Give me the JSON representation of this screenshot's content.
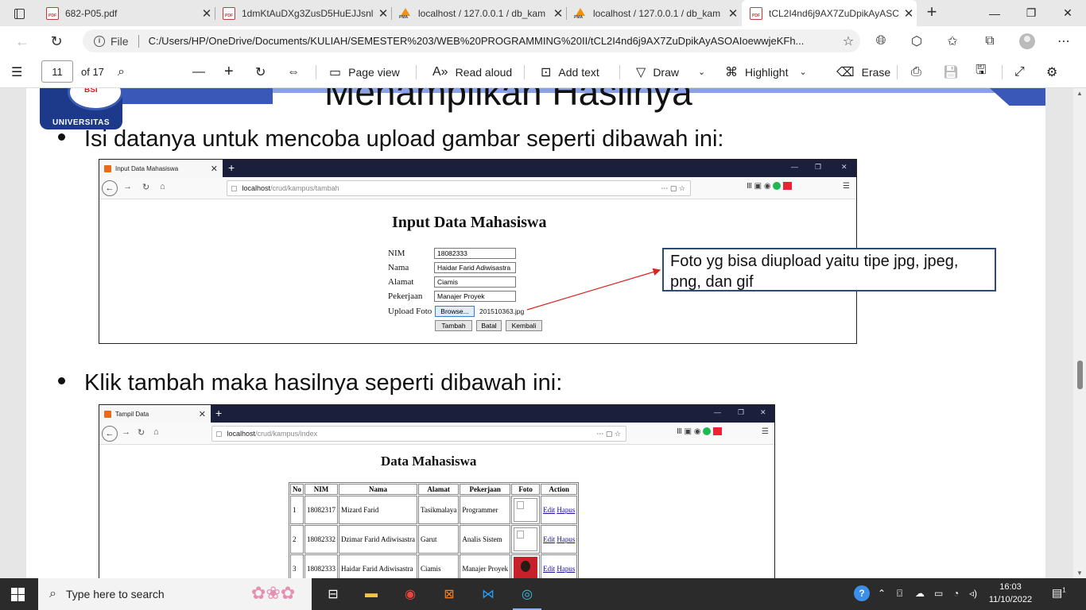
{
  "tabs": [
    {
      "title": "682-P05.pdf",
      "icon": "pdf-icon"
    },
    {
      "title": "1dmKtAuDXg3ZusD5HuEJJsnl",
      "icon": "pdf-icon"
    },
    {
      "title": "localhost / 127.0.0.1 / db_kam",
      "icon": "phpmyadmin-icon"
    },
    {
      "title": "localhost / 127.0.0.1 / db_kam",
      "icon": "phpmyadmin-icon"
    },
    {
      "title": "tCL2I4nd6j9AX7ZuDpikAyASC",
      "icon": "pdf-icon",
      "active": true
    }
  ],
  "address": {
    "label": "File",
    "url": "C:/Users/HP/OneDrive/Documents/KULIAH/SEMESTER%203/WEB%20PROGRAMMING%20II/tCL2I4nd6j9AX7ZuDpikAyASOAIoewwjeKFh..."
  },
  "pdf_toolbar": {
    "page_current": "11",
    "page_total": "of 17",
    "page_view": "Page view",
    "read_aloud": "Read aloud",
    "add_text": "Add text",
    "draw": "Draw",
    "highlight": "Highlight",
    "erase": "Erase"
  },
  "slide": {
    "title": "Menampilkan Hasilnya",
    "logo_text": "UNIVERSITAS",
    "logo_mark": "BSI",
    "bullet1": "Isi datanya untuk mencoba upload gambar seperti dibawah ini:",
    "bullet2": "Klik tambah maka hasilnya seperti dibawah ini:",
    "callout": "Foto yg bisa diupload yaitu tipe jpg, jpeg, png, dan gif"
  },
  "shot1": {
    "tab_title": "Input Data Mahasiswa",
    "url_host": "localhost",
    "url_path": "/crud/kampus/tambah",
    "form_title": "Input Data Mahasiswa",
    "fields": [
      {
        "label": "NIM",
        "value": "18082333"
      },
      {
        "label": "Nama",
        "value": "Haidar Farid Adiwisastra"
      },
      {
        "label": "Alamat",
        "value": "Ciamis"
      },
      {
        "label": "Pekerjaan",
        "value": "Manajer Proyek"
      }
    ],
    "upload_label": "Upload Foto",
    "browse": "Browse...",
    "file_name": "201510363.jpg",
    "btn_add": "Tambah",
    "btn_cancel": "Batal",
    "btn_back": "Kembali"
  },
  "shot2": {
    "tab_title": "Tampil Data",
    "url_host": "localhost",
    "url_path": "/crud/kampus/index",
    "heading": "Data Mahasiswa",
    "columns": [
      "No",
      "NIM",
      "Nama",
      "Alamat",
      "Pekerjaan",
      "Foto",
      "Action"
    ],
    "rows": [
      {
        "no": "1",
        "nim": "18082317",
        "nama": "Mizard Farid",
        "alamat": "Tasikmalaya",
        "pekerjaan": "Programmer",
        "photo": false
      },
      {
        "no": "2",
        "nim": "18082332",
        "nama": "Dzimar Farid Adiwisastra",
        "alamat": "Garut",
        "pekerjaan": "Analis Sistem",
        "photo": false
      },
      {
        "no": "3",
        "nim": "18082333",
        "nama": "Haidar Farid Adiwisastra",
        "alamat": "Ciamis",
        "pekerjaan": "Manajer Proyek",
        "photo": true
      }
    ],
    "edit": "Edit",
    "delete": "Hapus"
  },
  "taskbar": {
    "search_placeholder": "Type here to search",
    "time": "16:03",
    "date": "11/10/2022",
    "notif_count": "1"
  }
}
